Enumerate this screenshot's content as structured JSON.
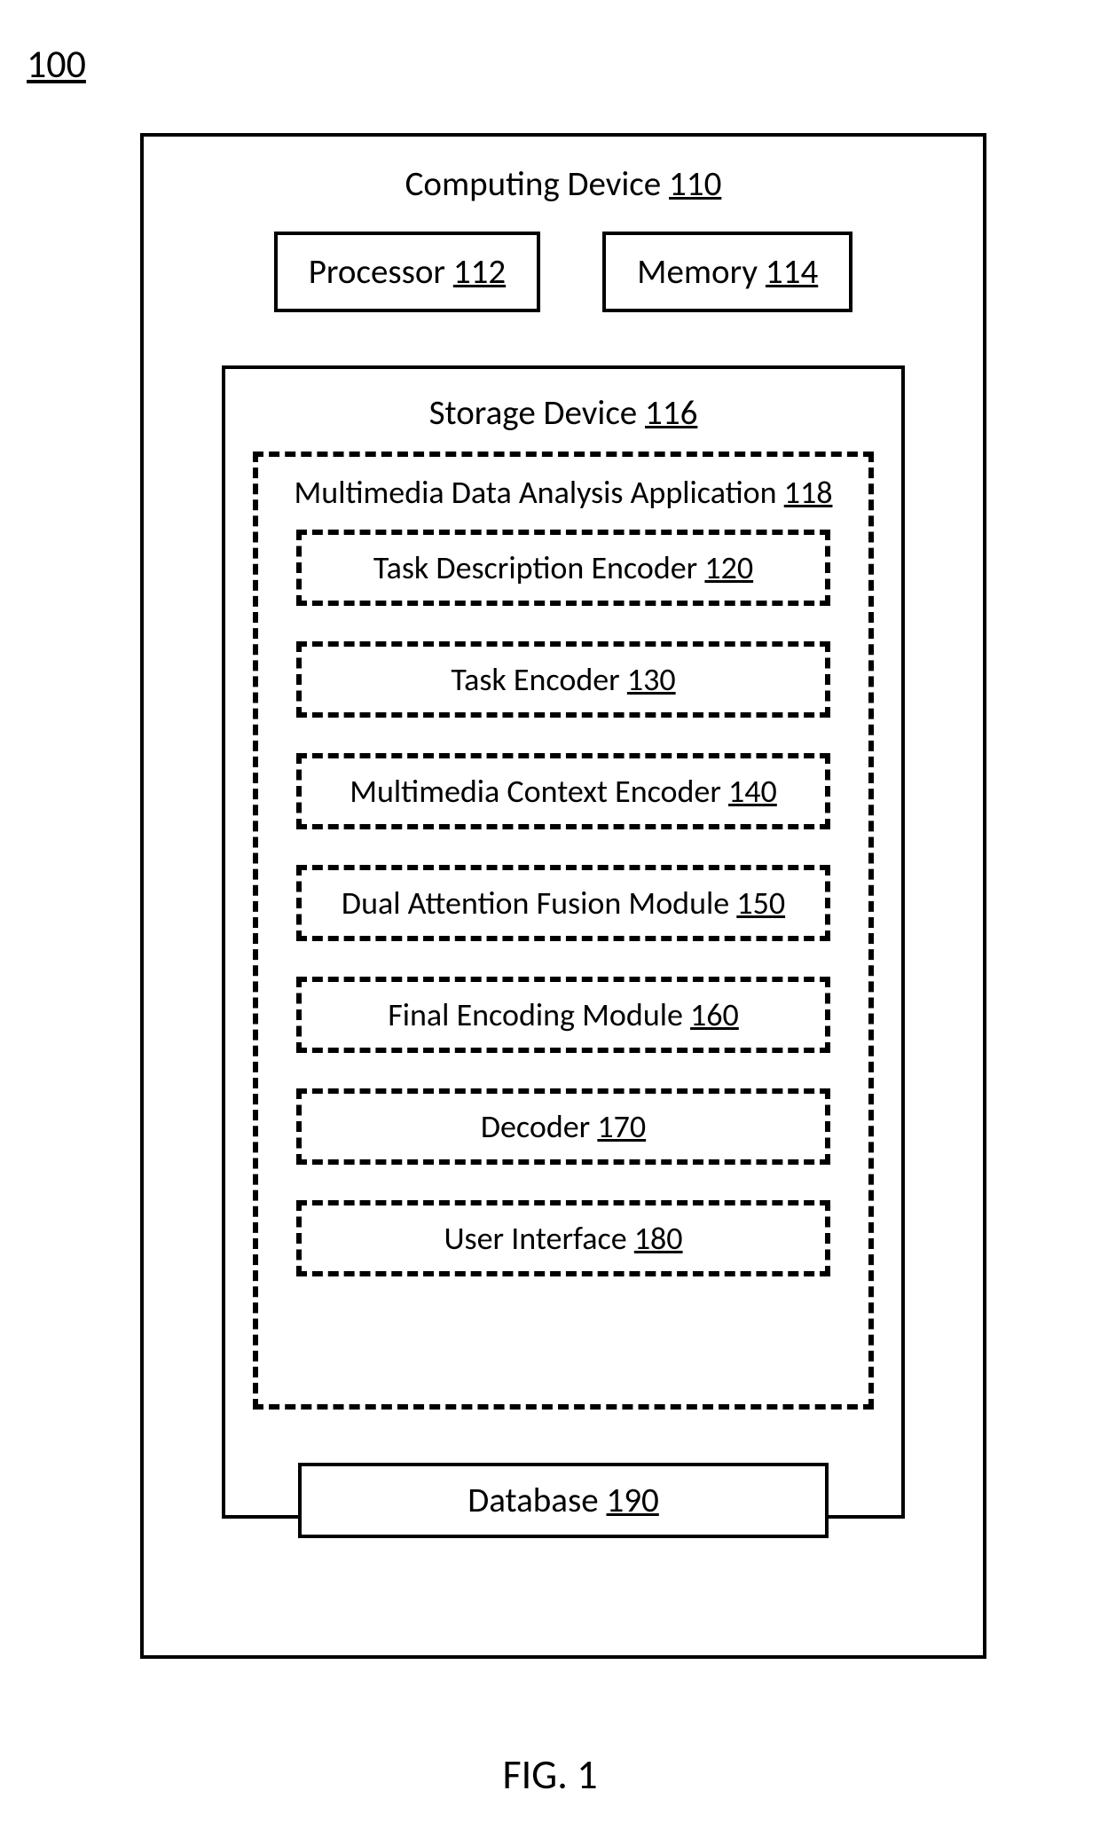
{
  "figure_ref": "100",
  "caption": "FIG. 1",
  "device": {
    "label": "Computing Device",
    "num": "110"
  },
  "processor": {
    "label": "Processor",
    "num": "112"
  },
  "memory": {
    "label": "Memory",
    "num": "114"
  },
  "storage": {
    "label": "Storage Device",
    "num": "116"
  },
  "app": {
    "label": "Multimedia Data Analysis Application",
    "num": "118"
  },
  "modules": [
    {
      "label": "Task Description Encoder",
      "num": "120"
    },
    {
      "label": "Task Encoder",
      "num": "130"
    },
    {
      "label": "Multimedia Context Encoder",
      "num": "140"
    },
    {
      "label": "Dual Attention Fusion Module",
      "num": "150"
    },
    {
      "label": "Final Encoding Module",
      "num": "160"
    },
    {
      "label": "Decoder",
      "num": "170"
    },
    {
      "label": "User Interface",
      "num": "180"
    }
  ],
  "database": {
    "label": "Database",
    "num": "190"
  }
}
